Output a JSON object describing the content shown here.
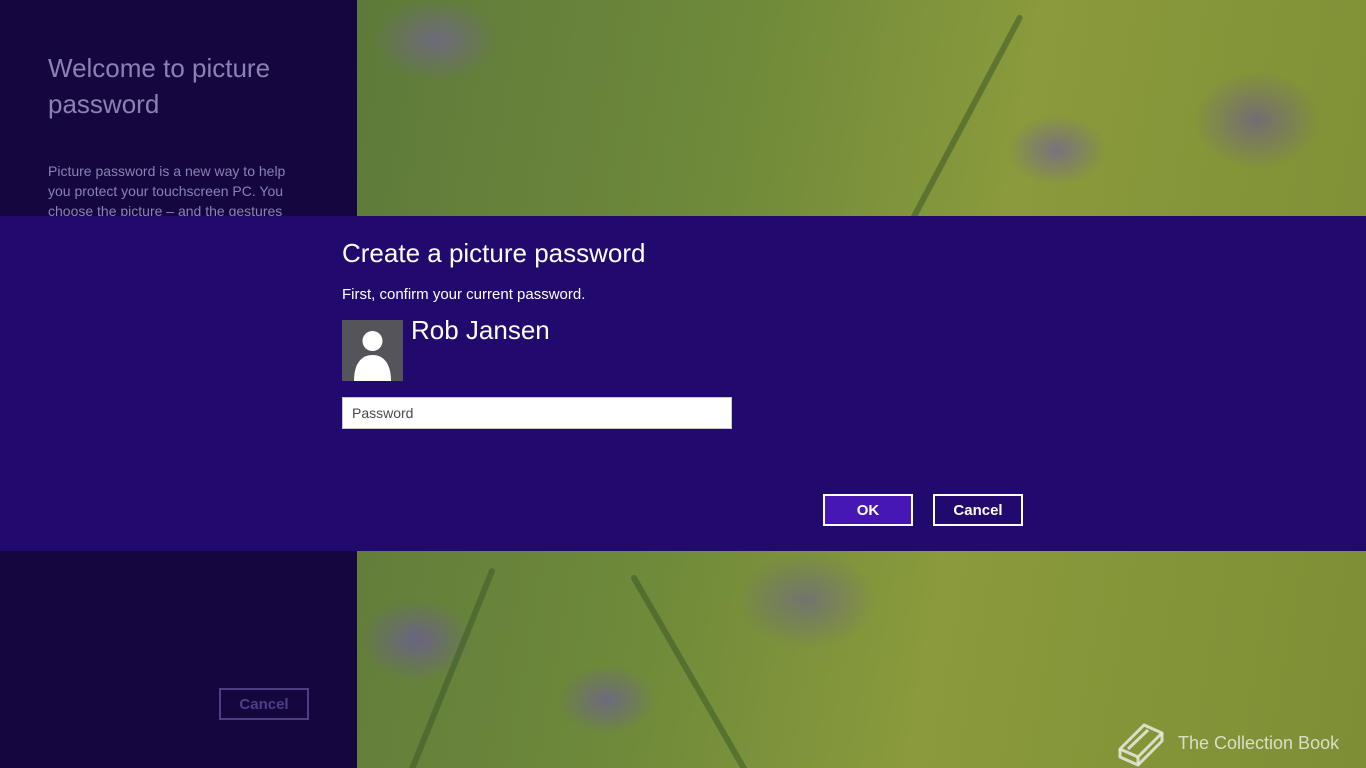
{
  "background_panel": {
    "title": "Welcome to picture password",
    "description": "Picture password is a new way to help you protect your touchscreen PC. You choose the picture – and the gestures",
    "cancel_label": "Cancel"
  },
  "dialog": {
    "title": "Create a picture password",
    "instruction": "First, confirm your current password.",
    "user_name": "Rob Jansen",
    "avatar_icon": "user-silhouette-icon",
    "password_placeholder": "Password",
    "password_value": "",
    "ok_label": "OK",
    "cancel_label": "Cancel"
  },
  "watermark": {
    "icon": "book-icon",
    "text": "The Collection Book"
  },
  "colors": {
    "dialog_background": "#22096e",
    "left_panel_background": "#15063f",
    "ok_button_fill": "#4617b4",
    "text_primary": "#ffffff",
    "text_muted": "#8c80b4"
  }
}
